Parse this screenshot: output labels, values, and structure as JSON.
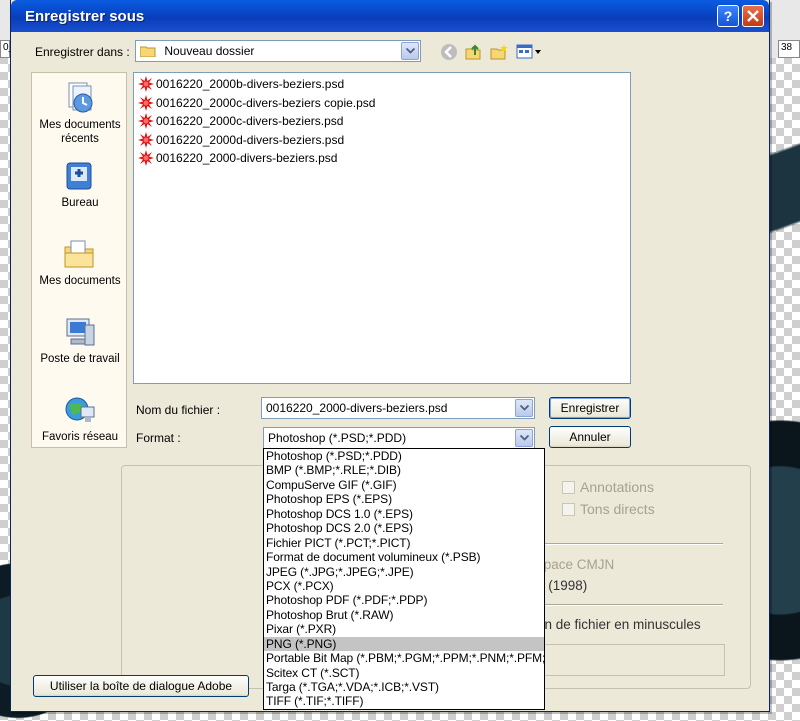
{
  "background": {
    "ruler_left": "0_",
    "ruler_right": "38"
  },
  "dialog": {
    "title": "Enregistrer sous",
    "save_in_label": "Enregistrer dans :",
    "save_in_value": "Nouveau dossier",
    "places": [
      {
        "label": "Mes documents récents",
        "icon": "recent-documents-icon"
      },
      {
        "label": "Bureau",
        "icon": "desktop-icon"
      },
      {
        "label": "Mes documents",
        "icon": "my-documents-icon"
      },
      {
        "label": "Poste de travail",
        "icon": "my-computer-icon"
      },
      {
        "label": "Favoris réseau",
        "icon": "network-places-icon"
      }
    ],
    "files": [
      "0016220_2000b-divers-beziers.psd",
      "0016220_2000c-divers-beziers copie.psd",
      "0016220_2000c-divers-beziers.psd",
      "0016220_2000d-divers-beziers.psd",
      "0016220_2000-divers-beziers.psd"
    ],
    "filename_label": "Nom du fichier :",
    "filename_value": "0016220_2000-divers-beziers.psd",
    "format_label": "Format :",
    "format_value": "Photoshop (*.PSD;*.PDD)",
    "save_button": "Enregistrer",
    "cancel_button": "Annuler",
    "adobe_dialog_button": "Utiliser la boîte de dialogue Adobe",
    "options": {
      "annotations": "Annotations",
      "spot_colors": "Tons directs",
      "cmyk_fragment": "space CMJN",
      "year_fragment": "3 (1998)",
      "lowercase_fragment": "on de fichier en minuscules"
    },
    "format_options": [
      "Photoshop (*.PSD;*.PDD)",
      "BMP (*.BMP;*.RLE;*.DIB)",
      "CompuServe GIF (*.GIF)",
      "Photoshop EPS (*.EPS)",
      "Photoshop DCS 1.0 (*.EPS)",
      "Photoshop DCS 2.0 (*.EPS)",
      "Fichier PICT (*.PCT;*.PICT)",
      "Format de document volumineux (*.PSB)",
      "JPEG (*.JPG;*.JPEG;*.JPE)",
      "PCX (*.PCX)",
      "Photoshop PDF (*.PDF;*.PDP)",
      "Photoshop Brut (*.RAW)",
      "Pixar (*.PXR)",
      "PNG (*.PNG)",
      "Portable Bit Map (*.PBM;*.PGM;*.PPM;*.PNM;*.PFM;",
      "Scitex CT (*.SCT)",
      "Targa (*.TGA;*.VDA;*.ICB;*.VST)",
      "TIFF (*.TIF;*.TIFF)"
    ],
    "selected_format_index": 13
  },
  "colors": {
    "titlebar": "#0a4fd0",
    "dialog_bg": "#ece9d8",
    "selection": "#c4c4c4"
  }
}
